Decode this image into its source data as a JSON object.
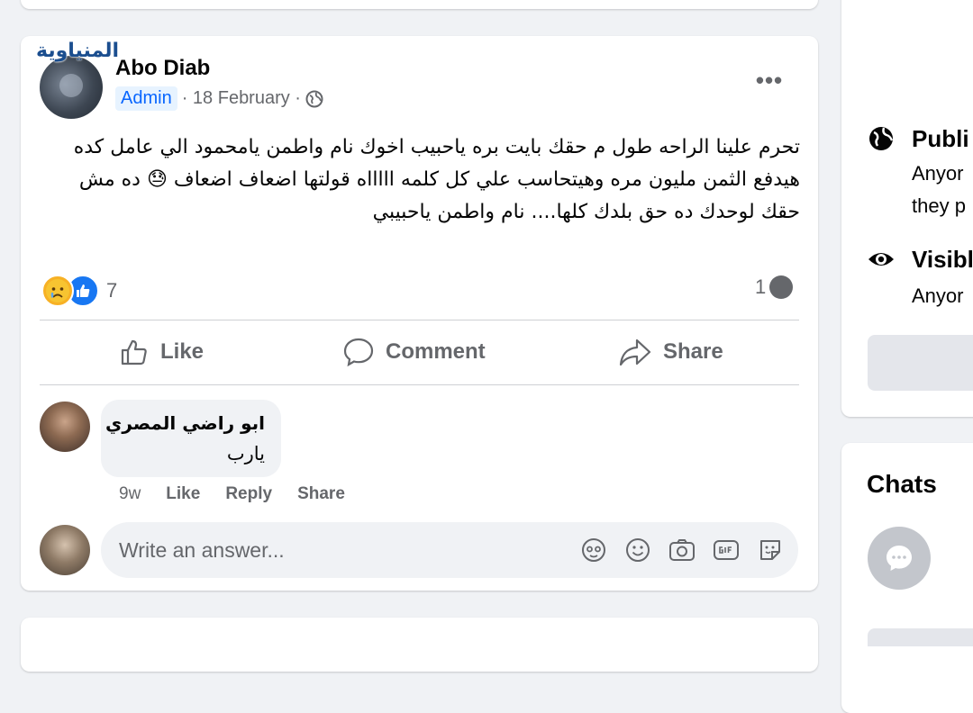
{
  "watermark": "المنياوية",
  "post": {
    "author": "Abo Diab",
    "role_badge": "Admin",
    "date": "· 18 February ·",
    "more_label": "•••",
    "text": "تحرم علينا الراحه طول م حقك بايت بره ياحبيب اخوك نام واطمن يامحمود الي عامل كده هيدفع الثمن مليون مره وهيتحاسب علي كل كلمه اااااه قولتها اضعاف اضعاف 😓 ده مش حقك لوحدك ده حق بلدك كلها.... نام واطمن ياحبيبي",
    "reaction_count": "7",
    "comment_count": "1",
    "reactions": [
      "sad-reaction",
      "like-reaction"
    ]
  },
  "actions": {
    "like": "Like",
    "comment": "Comment",
    "share": "Share"
  },
  "comment": {
    "author": "ابو راضي المصري",
    "text": "يارب",
    "time": "9w",
    "like": "Like",
    "reply": "Reply",
    "share": "Share"
  },
  "answer": {
    "placeholder": "Write an answer..."
  },
  "sidebar": {
    "public_title": "Publi",
    "public_sub1": "Anyor",
    "public_sub2": "they p",
    "visible_title": "Visibl",
    "visible_sub": "Anyor",
    "chats_title": "Chats"
  }
}
